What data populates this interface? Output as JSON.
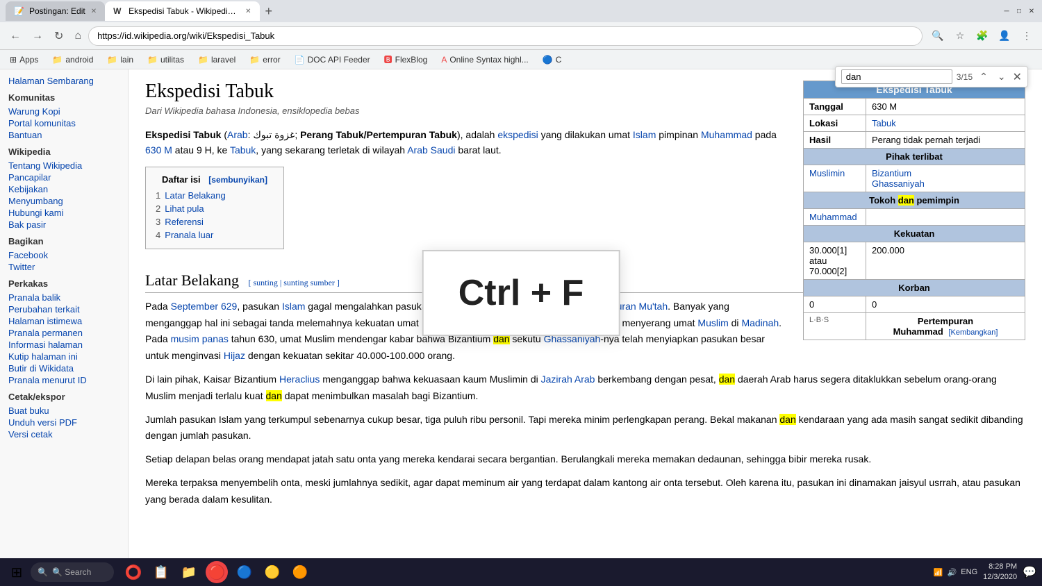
{
  "browser": {
    "tabs": [
      {
        "id": 1,
        "title": "Postingan: Edit",
        "favicon": "📝",
        "active": false
      },
      {
        "id": 2,
        "title": "Ekspedisi Tabuk - Wikipedia bah...",
        "favicon": "W",
        "active": true
      }
    ],
    "new_tab_label": "+",
    "address": "https://id.wikipedia.org/wiki/Ekspedisi_Tabuk",
    "window_controls": [
      "─",
      "□",
      "✕"
    ]
  },
  "bookmarks": [
    {
      "label": "Apps",
      "icon": "⊞"
    },
    {
      "label": "android",
      "icon": "📁"
    },
    {
      "label": "lain",
      "icon": "📁"
    },
    {
      "label": "utilitas",
      "icon": "📁"
    },
    {
      "label": "laravel",
      "icon": "📁"
    },
    {
      "label": "error",
      "icon": "📁"
    },
    {
      "label": "DOC API Feeder",
      "icon": "📄"
    },
    {
      "label": "FlexBlog",
      "icon": "🅱"
    },
    {
      "label": "Online Syntax highl...",
      "icon": "A"
    },
    {
      "label": "C",
      "icon": "🔵"
    }
  ],
  "find_bar": {
    "query": "dan",
    "count": "3/15",
    "prev_label": "▲",
    "next_label": "▼",
    "close_label": "✕"
  },
  "sidebar": {
    "top_link": "Halaman Sembarang",
    "sections": [
      {
        "title": "Komunitas",
        "links": [
          "Warung Kopi",
          "Portal komunitas",
          "Bantuan"
        ]
      },
      {
        "title": "Wikipedia",
        "links": [
          "Tentang Wikipedia",
          "Pancapilar",
          "Kebijakan",
          "Menyumbang",
          "Hubungi kami",
          "Bak pasir"
        ]
      },
      {
        "title": "Bagikan",
        "links": [
          "Facebook",
          "Twitter"
        ]
      },
      {
        "title": "Perkakas",
        "links": [
          "Pranala balik",
          "Perubahan terkait",
          "Halaman istimewa",
          "Pranala permanen",
          "Informasi halaman",
          "Kutip halaman ini",
          "Butir di Wikidata",
          "Pranala menurut ID"
        ]
      },
      {
        "title": "Cetak/ekspor",
        "links": [
          "Buat buku",
          "Unduh versi PDF",
          "Versi cetak"
        ]
      }
    ]
  },
  "article": {
    "title": "Ekspedisi Tabuk",
    "subtitle": "Dari Wikipedia bahasa Indonesia, ensiklopedia bebas",
    "intro": "Ekspedisi Tabuk (Arab: غزوة تبوك; Perang Tabuk/Pertempuran Tabuk), adalah ekspedisi yang dilakukan umat Islam pimpinan Muhammad pada 630 M atau 9 H, ke Tabuk, yang sekarang terletak di wilayah Arab Saudi barat laut.",
    "toc": {
      "title": "Daftar isi",
      "hide_label": "[sembunyikan]",
      "items": [
        {
          "num": "1",
          "label": "Latar Belakang"
        },
        {
          "num": "2",
          "label": "Lihat pula"
        },
        {
          "num": "3",
          "label": "Referensi"
        },
        {
          "num": "4",
          "label": "Pranala luar"
        }
      ]
    },
    "sections": [
      {
        "heading": "Latar Belakang",
        "edit_links": "[ sunting | sunting sumber ]",
        "paragraphs": [
          "Pada September 629, pasukan Islam gagal mengalahkan pasukan Bizantium (Romawi Timur) dalam pertempuran Mu'tah. Banyak yang menganggap hal ini sebagai tanda melemahnya kekuatan umat Islam, dan memancing beberapa kabilah Arab menyerang umat Muslim di Madinah. Pada musim panas tahun 630, umat Muslim mendengar kabar bahwa Bizantium dan sekutu Ghassaniyah-nya telah menyiapkan pasukan besar untuk menginvasi Hijaz dengan kekuatan sekitar 40.000-100.000 orang.",
          "Di lain pihak, Kaisar Bizantium Heraclius menganggap bahwa kekuasaan kaum Muslimin di Jazirah Arab berkembang dengan pesat, dan daerah Arab harus segera ditaklukkan sebelum orang-orang Muslim menjadi terlalu kuat dan dapat menimbulkan masalah bagi Bizantium.",
          "Jumlah pasukan Islam yang terkumpul sebenarnya cukup besar, tiga puluh ribu personil. Tapi mereka minim perlengkapan perang. Bekal makanan dan kendaraan yang ada masih sangat sedikit dibanding dengan jumlah pasukan.",
          "Setiap delapan belas orang mendapat jatah satu onta yang mereka kendarai secara bergantian. Berulangkali mereka memakan dedaunan, sehingga bibir mereka rusak.",
          "Mereka terpaksa menyembelih onta, meski jumlahnya sedikit, agar dapat meminum air yang terdapat dalam kantong air onta tersebut. Oleh karena itu, pasukan ini dinamakan jaisyul usrrah, atau pasukan yang berada dalam kesulitan."
        ]
      }
    ],
    "infobox": {
      "header": "Ekspedisi Tabuk",
      "rows": [
        {
          "label": "Tanggal",
          "value": "630 M"
        },
        {
          "label": "Lokasi",
          "value": "Tabuk",
          "link": true
        },
        {
          "label": "Hasil",
          "value": "Perang tidak pernah terjadi"
        }
      ],
      "subheader1": "Pihak terlibat",
      "sides": [
        {
          "value": "Muslimin",
          "link": true
        },
        {
          "values": [
            "Bizantium",
            "Ghassaniyah"
          ],
          "links": true
        }
      ],
      "subheader2": "Tokoh dan pemimpin",
      "leaders": [
        {
          "value": "Muhammad",
          "link": true
        },
        {
          "value": ""
        }
      ],
      "subheader3": "Kekuatan",
      "strength": [
        "30.000[1] atau 70.000[2]",
        "200.000"
      ],
      "subheader4": "Korban",
      "casualties": [
        "0",
        "0"
      ],
      "footer_left": "L·B·S",
      "footer_center": "Pertempuran Muhammad",
      "footer_right": "[Kembangkan]"
    }
  },
  "shortcut_overlay": {
    "text": "Ctrl + F"
  },
  "taskbar": {
    "start_icon": "⊞",
    "search_placeholder": "🔍  Search",
    "icons": [
      "⭕",
      "📋",
      "📁",
      "🔴",
      "🔵",
      "🟡",
      "🟠"
    ],
    "sys_tray": {
      "time": "8:28 PM",
      "date": "12/3/2020",
      "lang": "ENG"
    }
  }
}
